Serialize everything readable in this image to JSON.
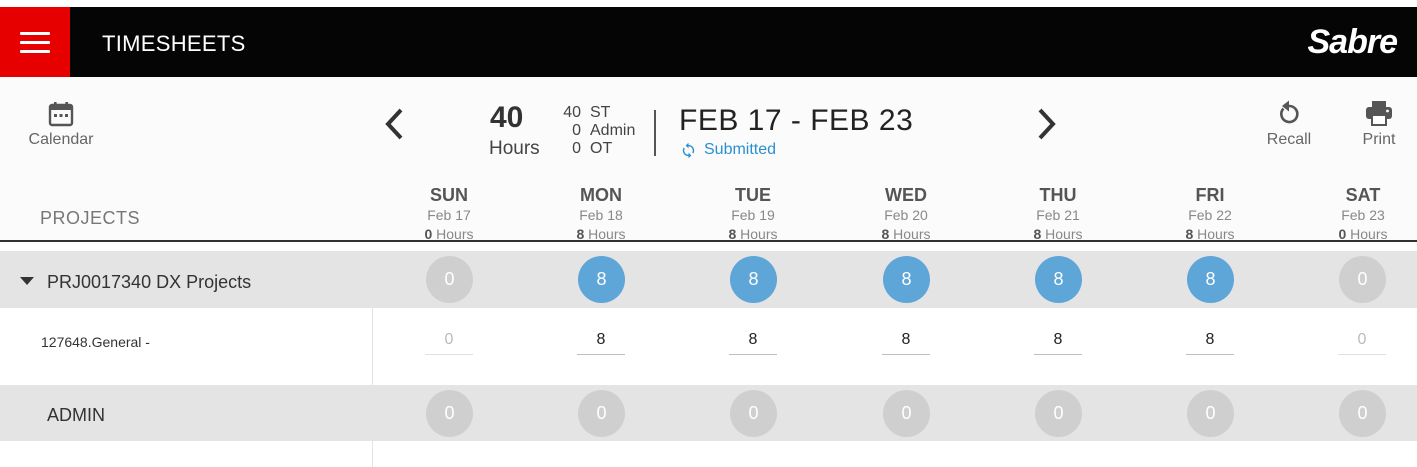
{
  "header": {
    "title": "TIMESHEETS",
    "logo_text": "Sabre",
    "menu_icon": "hamburger-icon",
    "bar_color": "#050505",
    "menu_color": "#e60000"
  },
  "toolbar": {
    "calendar_label": "Calendar",
    "recall_label": "Recall",
    "print_label": "Print"
  },
  "summary": {
    "total": "40",
    "total_label": "Hours",
    "breakdown": [
      {
        "value": "40",
        "label": "ST"
      },
      {
        "value": "0",
        "label": "Admin"
      },
      {
        "value": "0",
        "label": "OT"
      }
    ],
    "range": "FEB 17 - FEB 23",
    "status": "Submitted"
  },
  "grid": {
    "projects_label": "PROJECTS",
    "days": [
      {
        "name": "SUN",
        "date": "Feb 17",
        "hours": "0",
        "hours_label": "Hours"
      },
      {
        "name": "MON",
        "date": "Feb 18",
        "hours": "8",
        "hours_label": "Hours"
      },
      {
        "name": "TUE",
        "date": "Feb 19",
        "hours": "8",
        "hours_label": "Hours"
      },
      {
        "name": "WED",
        "date": "Feb 20",
        "hours": "8",
        "hours_label": "Hours"
      },
      {
        "name": "THU",
        "date": "Feb 21",
        "hours": "8",
        "hours_label": "Hours"
      },
      {
        "name": "FRI",
        "date": "Feb 22",
        "hours": "8",
        "hours_label": "Hours"
      },
      {
        "name": "SAT",
        "date": "Feb 23",
        "hours": "0",
        "hours_label": "Hours"
      }
    ]
  },
  "project": {
    "title": "PRJ0017340 DX Projects",
    "totals": [
      "0",
      "8",
      "8",
      "8",
      "8",
      "8",
      "0"
    ],
    "task": {
      "label": "127648.General -",
      "values": [
        "0",
        "8",
        "8",
        "8",
        "8",
        "8",
        "0"
      ]
    }
  },
  "admin": {
    "title": "ADMIN",
    "totals": [
      "0",
      "0",
      "0",
      "0",
      "0",
      "0",
      "0"
    ]
  },
  "colors": {
    "accent_blue": "#5ea5d8",
    "status_blue": "#2a8fd0",
    "circle_grey": "#cfcfcf"
  }
}
